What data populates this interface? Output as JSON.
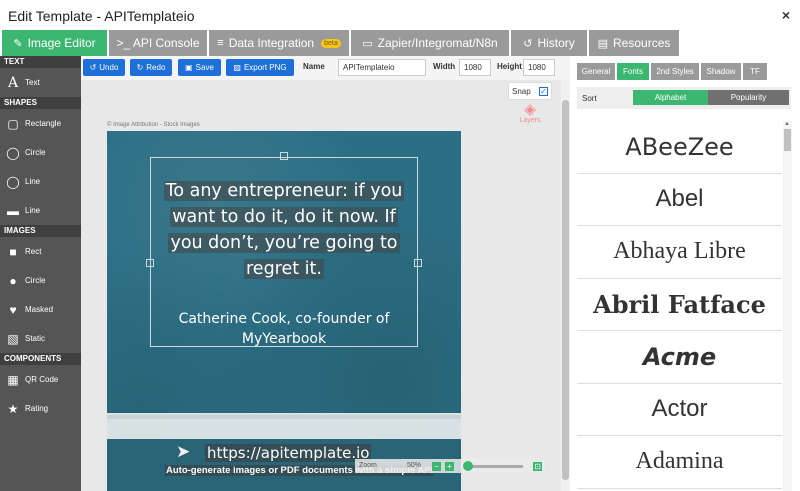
{
  "window": {
    "title": "Edit Template - APITemplateio",
    "close_glyph": "×"
  },
  "tabs": [
    {
      "label": "Image Editor",
      "icon": "✎",
      "active": true
    },
    {
      "label": ">_ API Console",
      "icon": ""
    },
    {
      "label": "Data Integration",
      "icon": "≡",
      "badge": "beta"
    },
    {
      "label": "Zapier/Integromat/N8n",
      "icon": "▭"
    },
    {
      "label": "History",
      "icon": "↺"
    },
    {
      "label": "Resources",
      "icon": "▤"
    }
  ],
  "sidebar": {
    "sections": [
      {
        "title": "TEXT",
        "items": [
          {
            "label": "Text",
            "icon": "text-icon"
          }
        ]
      },
      {
        "title": "SHAPES",
        "items": [
          {
            "label": "Rectangle",
            "icon": "rectangle-icon"
          },
          {
            "label": "Circle",
            "icon": "circle-icon"
          },
          {
            "label": "Line",
            "icon": "line-circle-icon"
          },
          {
            "label": "Line",
            "icon": "line-icon"
          }
        ]
      },
      {
        "title": "IMAGES",
        "items": [
          {
            "label": "Rect",
            "icon": "rect-image-icon"
          },
          {
            "label": "Circle",
            "icon": "circle-image-icon"
          },
          {
            "label": "Masked",
            "icon": "heart-icon"
          },
          {
            "label": "Static",
            "icon": "picture-icon"
          }
        ]
      },
      {
        "title": "COMPONENTS",
        "items": [
          {
            "label": "QR Code",
            "icon": "qr-code-icon"
          },
          {
            "label": "Rating",
            "icon": "star-icon"
          }
        ]
      }
    ]
  },
  "toolbar": {
    "undo": "Undo",
    "redo": "Redo",
    "save": "Save",
    "export_png": "Export PNG",
    "name_label": "Name",
    "name_value": "APITemplateio",
    "width_label": "Width",
    "width_value": "1080",
    "height_label": "Height",
    "height_value": "1080"
  },
  "canvas": {
    "snap_label": "Snap",
    "snap_checked": true,
    "layers_label": "Layers",
    "attribution": "© Image Attribution - Stock Images",
    "quote": [
      "To any entrepreneur: if you",
      "want to do it, do it now. If",
      "you don’t, you’re going to",
      "regret it."
    ],
    "author": [
      "Catherine Cook, co-founder of",
      "MyYearbook"
    ],
    "url": "https://apitemplate.io",
    "tagline": "Auto-generate images or PDF documents with a simple API",
    "zoom_label": "Zoom",
    "zoom_value": "50%"
  },
  "right_panel": {
    "tabs": [
      "General",
      "Fonts",
      "2nd Styles",
      "Shadow",
      "TF"
    ],
    "active_tab": "Fonts",
    "sort_label": "Sort",
    "sort_options": [
      "Alphabet",
      "Popularity"
    ],
    "sort_active": "Alphabet",
    "fonts": [
      "ABeeZee",
      "Abel",
      "Abhaya Libre",
      "Abril Fatface",
      "Acme",
      "Actor",
      "Adamina"
    ]
  },
  "colors": {
    "accent": "#3cb771",
    "primary_button": "#1e6fd9",
    "tab_inactive": "#9a9a9a",
    "sidebar": "#555555",
    "poster_bg": "#2c6f85"
  }
}
